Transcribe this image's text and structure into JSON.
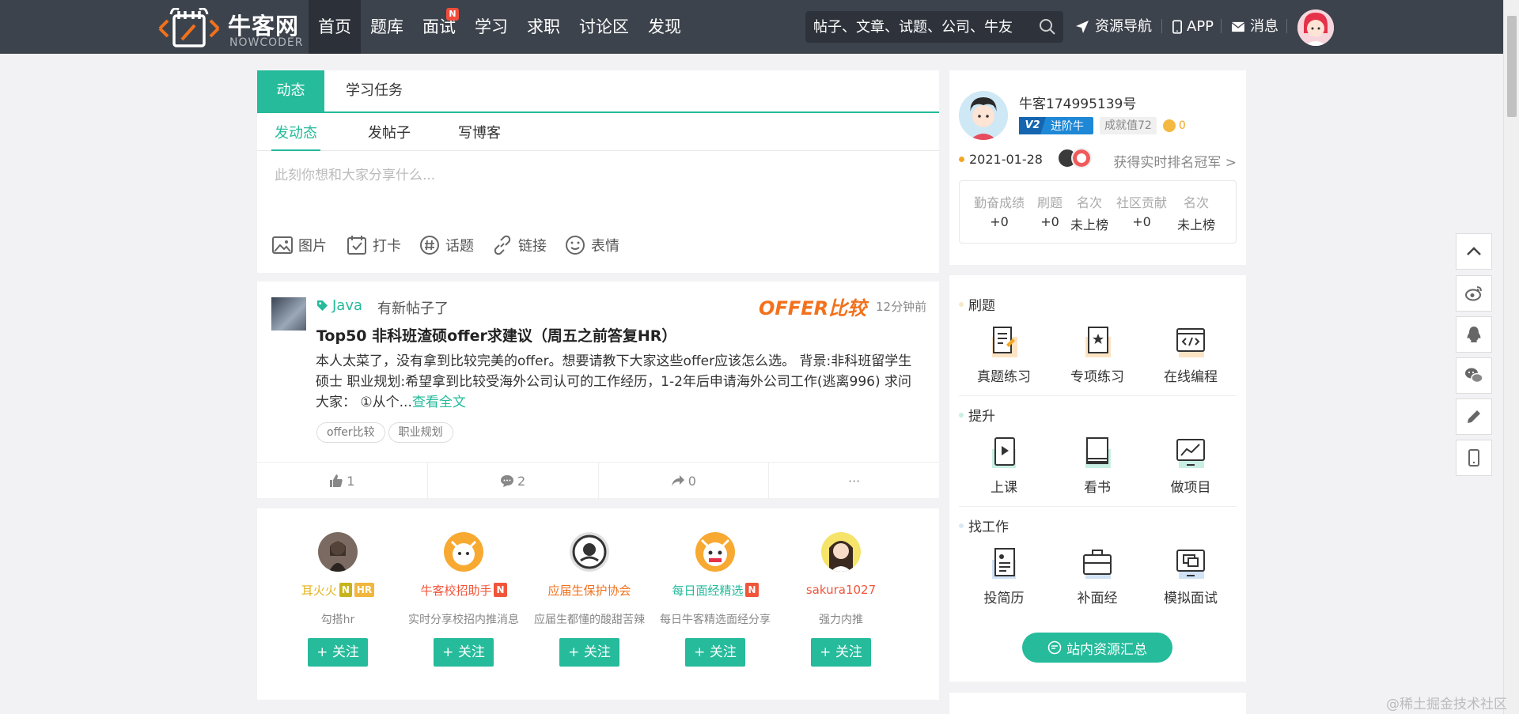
{
  "brand": {
    "name_cn": "牛客网",
    "name_en": "NOWCODER"
  },
  "nav": [
    {
      "label": "首页",
      "active": true
    },
    {
      "label": "题库"
    },
    {
      "label": "面试",
      "badge": "N"
    },
    {
      "label": "学习"
    },
    {
      "label": "求职"
    },
    {
      "label": "讨论区"
    },
    {
      "label": "发现"
    }
  ],
  "search": {
    "placeholder": "帖子、文章、试题、公司、牛友"
  },
  "top_links": {
    "resources": "资源导航",
    "app": "APP",
    "messages": "消息"
  },
  "composer": {
    "tabs": [
      "动态",
      "学习任务"
    ],
    "subtabs": [
      "发动态",
      "发帖子",
      "写博客"
    ],
    "placeholder": "此刻你想和大家分享什么...",
    "tools": [
      "图片",
      "打卡",
      "话题",
      "链接",
      "表情"
    ]
  },
  "post": {
    "topic": "Java",
    "action": "有新帖子了",
    "brand_text": "OFFER比较",
    "time": "12分钟前",
    "title": "Top50 非科班渣硕offer求建议（周五之前答复HR）",
    "body": " 本人太菜了，没有拿到比较完美的offer。想要请教下大家这些offer应该怎么选。   背景:非科班留学生硕士   职业规划:希望拿到比较受海外公司认可的工作经历，1-2年后申请海外公司工作(逃离996)     求问大家：   ①从个...",
    "more": "查看全文",
    "tags": [
      "offer比较",
      "职业规划"
    ],
    "likes": "1",
    "comments": "2",
    "shares": "0",
    "more_actions": "···"
  },
  "recommend": [
    {
      "name": "耳火火",
      "badges": [
        "N",
        "HR"
      ],
      "desc": "勾搭hr",
      "follow": "+ 关注",
      "color": "#e6b422"
    },
    {
      "name": "牛客校招助手",
      "badges": [
        "N"
      ],
      "desc": "实时分享校招内推消息",
      "follow": "+ 关注",
      "color": "#f0553a"
    },
    {
      "name": "应届生保护协会",
      "badges": [],
      "desc": "应届生都懂的酸甜苦辣",
      "follow": "+ 关注",
      "color": "#f2711c"
    },
    {
      "name": "每日面经精选",
      "badges": [
        "N"
      ],
      "desc": "每日牛客精选面经分享",
      "follow": "+ 关注",
      "color": "#25bb9b"
    },
    {
      "name": "sakura1027",
      "badges": [],
      "desc": "强力内推",
      "follow": "+ 关注",
      "color": "#f0553a"
    }
  ],
  "user": {
    "name": "牛客174995139号",
    "level_badge": "V2",
    "level_name": "进阶牛",
    "achievement": "成就值72",
    "coins": "0",
    "date": "2021-01-28",
    "rank_link": "获得实时排名冠军 >",
    "stats": [
      {
        "label": "勤奋成绩",
        "value": "+0"
      },
      {
        "label": "刷题",
        "value": "+0"
      },
      {
        "label": "名次",
        "value": "未上榜"
      },
      {
        "label": "社区贡献",
        "value": "+0"
      },
      {
        "label": "名次",
        "value": "未上榜"
      }
    ]
  },
  "practice": {
    "sections": [
      {
        "title": "刷题",
        "items": [
          "真题练习",
          "专项练习",
          "在线编程"
        ]
      },
      {
        "title": "提升",
        "items": [
          "上课",
          "看书",
          "做项目"
        ]
      },
      {
        "title": "找工作",
        "items": [
          "投简历",
          "补面经",
          "模拟面试"
        ]
      }
    ],
    "resource_button": "站内资源汇总"
  },
  "watermark": "@稀土掘金技术社区"
}
